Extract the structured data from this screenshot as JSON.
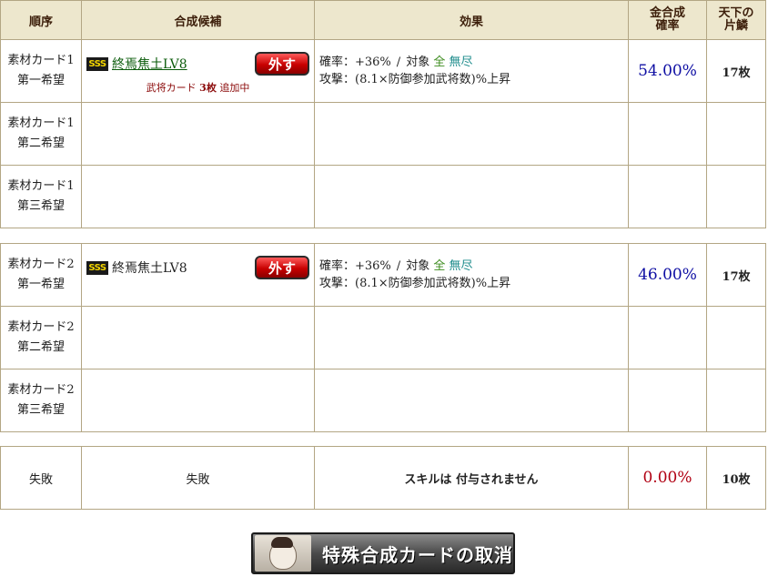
{
  "header": {
    "order": "順序",
    "candidate": "合成候補",
    "effect": "効果",
    "gold_prob_1": "金合成",
    "gold_prob_2": "確率",
    "scale_1": "天下の",
    "scale_2": "片鱗"
  },
  "group1": {
    "row1": {
      "order_1": "素材カード1",
      "order_2": "第一希望",
      "rank_badge": "SSS",
      "card_name": "終焉焦土LV8",
      "remove_label": "外す",
      "adding_prefix": "武将カード",
      "adding_count": "3枚",
      "adding_suffix": "追加中",
      "effect_rate": "確率：+36%",
      "effect_sep": "/",
      "effect_target": "対象",
      "effect_all": "全",
      "effect_unlimited": "無尽",
      "effect_attack": "攻撃：(8.1×防御参加武将数)%上昇",
      "prob": "54.00%",
      "scale": "17枚"
    },
    "row2": {
      "order_1": "素材カード1",
      "order_2": "第二希望"
    },
    "row3": {
      "order_1": "素材カード1",
      "order_2": "第三希望"
    }
  },
  "group2": {
    "row1": {
      "order_1": "素材カード2",
      "order_2": "第一希望",
      "rank_badge": "SSS",
      "card_name": "終焉焦土LV8",
      "remove_label": "外す",
      "effect_rate": "確率：+36%",
      "effect_sep": "/",
      "effect_target": "対象",
      "effect_all": "全",
      "effect_unlimited": "無尽",
      "effect_attack": "攻撃：(8.1×防御参加武将数)%上昇",
      "prob": "46.00%",
      "scale": "17枚"
    },
    "row2": {
      "order_1": "素材カード2",
      "order_2": "第二希望"
    },
    "row3": {
      "order_1": "素材カード2",
      "order_2": "第三希望"
    }
  },
  "fail": {
    "order": "失敗",
    "candidate": "失敗",
    "skill": "スキルは 付与されません",
    "prob": "0.00%",
    "scale": "10枚"
  },
  "cancel_button": {
    "label": "特殊合成カードの取消"
  }
}
